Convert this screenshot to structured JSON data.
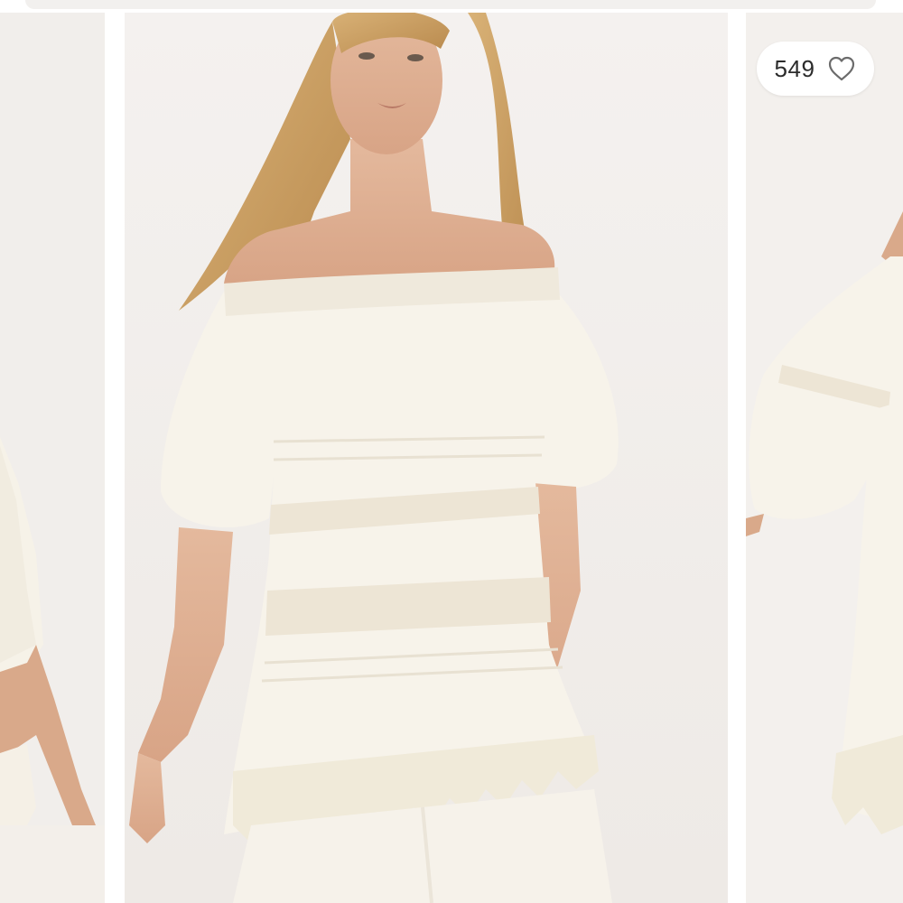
{
  "listing": {
    "like_count": "549"
  },
  "icons": {
    "like": "heart-outline-icon"
  },
  "colors": {
    "backdrop": "#f4f1ef",
    "garment": "#f7f3ea",
    "pill_bg": "#ffffff",
    "text": "#2b2b2b"
  }
}
